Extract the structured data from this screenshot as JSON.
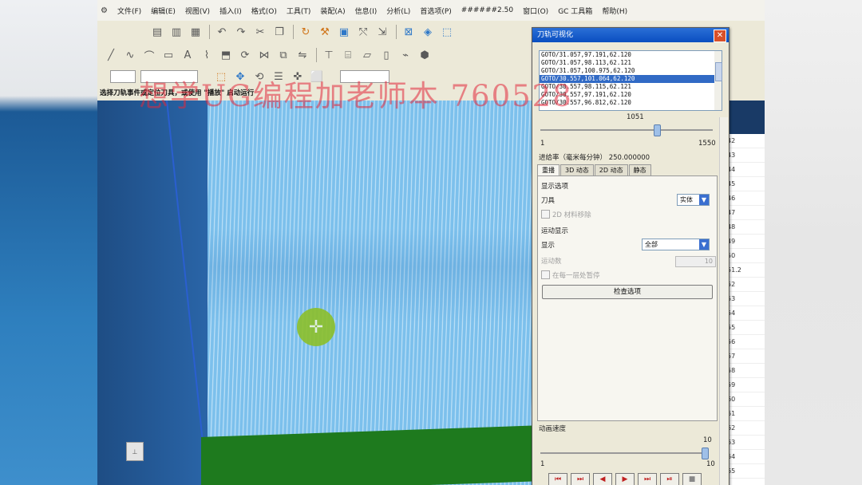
{
  "menubar": {
    "items": [
      "文件(F)",
      "编辑(E)",
      "视图(V)",
      "插入(I)",
      "格式(O)",
      "工具(T)",
      "装配(A)",
      "信息(I)",
      "分析(L)",
      "首选项(P)",
      "######2.50",
      "窗口(O)",
      "GC 工具箱",
      "帮助(H)"
    ]
  },
  "status_prompt": "选择刀轨事件或定位刀具，或使用 \"播放\" 启动运行",
  "watermark": "想学UG编程加老师本 760528",
  "dialog": {
    "title": "刀轨可视化",
    "toolpath_lines": [
      "GOTO/31.057,97.191,62.120",
      "GOTO/31.057,98.113,62.121",
      "GOTO/31.057,100.975,62.120",
      "GOTO/30.557,101.064,62.120",
      "GOTO/30.557,98.115,62.121",
      "GOTO/30.557,97.191,62.120",
      "GOTO/30.557,96.812,62.120"
    ],
    "selected_index": 3,
    "position_slider": {
      "value": "1051",
      "min": "1",
      "max": "1550",
      "fraction": 0.678
    },
    "feed_rate": "进给率（毫米每分钟） 250.000000",
    "tabs": [
      "重播",
      "3D 动态",
      "2D 动态",
      "静态"
    ],
    "active_tab": 0,
    "display_options_label": "显示选项",
    "tool_label": "刀具",
    "tool_value": "实体",
    "material_removal_label": "2D 材料移除",
    "motion_display_label": "运动显示",
    "display_label": "显示",
    "display_value": "全部",
    "count_label": "运动数",
    "count_value": "10",
    "single_step_label": "在每一层处暂停",
    "check_options_button": "检查选项",
    "anim_speed_label": "动画速度",
    "anim_speed": {
      "value": "10",
      "min": "1",
      "max": "10",
      "fraction": 1.0
    },
    "play_buttons": [
      "⏮",
      "⏭",
      "◀",
      "▶",
      "⏭",
      "⏯",
      "■"
    ]
  },
  "right_column": [
    "42",
    "43",
    "44",
    "45",
    "46",
    "47",
    "48",
    "49",
    "50",
    "51.2",
    "52",
    "53",
    "54",
    "55",
    "56",
    "57",
    "58",
    "59",
    "60",
    "61",
    "62",
    "63",
    "64",
    "65"
  ],
  "colors": {
    "part": "#7cc0ec",
    "floor": "#1e7a1e",
    "title_bar": "#0a4ec0",
    "cursor": "#8cbf2a"
  }
}
